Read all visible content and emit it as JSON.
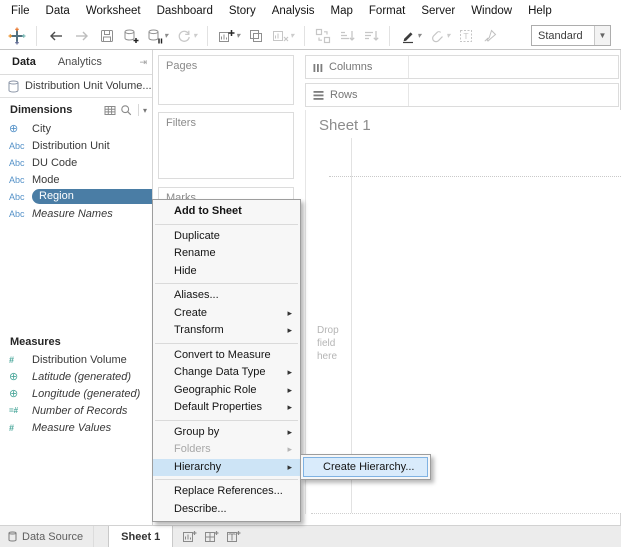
{
  "menu_bar": {
    "items": [
      "File",
      "Data",
      "Worksheet",
      "Dashboard",
      "Story",
      "Analysis",
      "Map",
      "Format",
      "Server",
      "Window",
      "Help"
    ]
  },
  "toolbar": {
    "fit_selector": {
      "value": "Standard"
    },
    "icons": [
      "tableau-logo-icon",
      "back-icon",
      "forward-icon",
      "save-icon",
      "new-data-source-icon",
      "pause-auto-updates-icon",
      "refresh-icon",
      "new-worksheet-icon",
      "duplicate-sheet-icon",
      "clear-sheet-icon",
      "swap-rows-columns-icon",
      "sort-ascending-icon",
      "sort-descending-icon",
      "highlight-icon",
      "group-members-icon",
      "show-mark-labels-icon",
      "fix-axes-icon"
    ]
  },
  "data_pane": {
    "tabs": [
      {
        "label": "Data",
        "active": true
      },
      {
        "label": "Analytics",
        "active": false
      }
    ],
    "data_source": {
      "name": "Distribution Unit Volume..."
    },
    "dimensions": {
      "title": "Dimensions",
      "fields": [
        {
          "name": "City",
          "icon": "globe-icon"
        },
        {
          "name": "Distribution Unit",
          "icon": "abc-icon"
        },
        {
          "name": "DU Code",
          "icon": "abc-icon"
        },
        {
          "name": "Mode",
          "icon": "abc-icon"
        },
        {
          "name": "Region",
          "icon": "abc-icon",
          "selected": true
        },
        {
          "name": "Measure Names",
          "icon": "abc-icon",
          "italic": true
        }
      ]
    },
    "measures": {
      "title": "Measures",
      "fields": [
        {
          "name": "Distribution Volume",
          "icon": "number-icon"
        },
        {
          "name": "Latitude (generated)",
          "icon": "globe-icon",
          "italic": true
        },
        {
          "name": "Longitude (generated)",
          "icon": "globe-icon",
          "italic": true
        },
        {
          "name": "Number of Records",
          "icon": "number-records-icon",
          "italic": true
        },
        {
          "name": "Measure Values",
          "icon": "number-icon",
          "italic": true
        }
      ]
    }
  },
  "icon_glyphs": {
    "abc": "Abc",
    "globe": "⊕",
    "hash": "#",
    "hash_records": "=#"
  },
  "shelves": {
    "pages_label": "Pages",
    "filters_label": "Filters",
    "marks_label": "Marks",
    "columns_label": "Columns",
    "rows_label": "Rows"
  },
  "canvas": {
    "sheet_title": "Sheet 1",
    "drop_hint_lines": [
      "Drop",
      "field",
      "here"
    ]
  },
  "context_menu": {
    "items": [
      {
        "label": "Add to Sheet",
        "bold": true
      },
      {
        "label": "Duplicate"
      },
      {
        "label": "Rename"
      },
      {
        "label": "Hide"
      },
      {
        "label": "Aliases..."
      },
      {
        "label": "Create",
        "submenu": true
      },
      {
        "label": "Transform",
        "submenu": true
      },
      {
        "label": "Convert to Measure"
      },
      {
        "label": "Change Data Type",
        "submenu": true
      },
      {
        "label": "Geographic Role",
        "submenu": true
      },
      {
        "label": "Default Properties",
        "submenu": true
      },
      {
        "label": "Group by",
        "submenu": true
      },
      {
        "label": "Folders",
        "submenu": true,
        "disabled": true
      },
      {
        "label": "Hierarchy",
        "submenu": true,
        "highlighted": true
      },
      {
        "label": "Replace References..."
      },
      {
        "label": "Describe..."
      }
    ]
  },
  "hierarchy_submenu": {
    "items": [
      {
        "label": "Create Hierarchy...",
        "highlighted": true
      }
    ]
  },
  "bottom_bar": {
    "tabs": [
      {
        "label": "Data Source",
        "active": false
      },
      {
        "label": "Sheet 1",
        "active": true
      }
    ],
    "icons": [
      "new-worksheet-icon",
      "new-dashboard-icon",
      "new-story-icon"
    ]
  },
  "colors": {
    "selected_pill": "#4a7da5",
    "menu_highlight": "#cde4f6",
    "submenu_item_bg": "#d9ebfb",
    "submenu_item_border": "#7fb2e2"
  }
}
